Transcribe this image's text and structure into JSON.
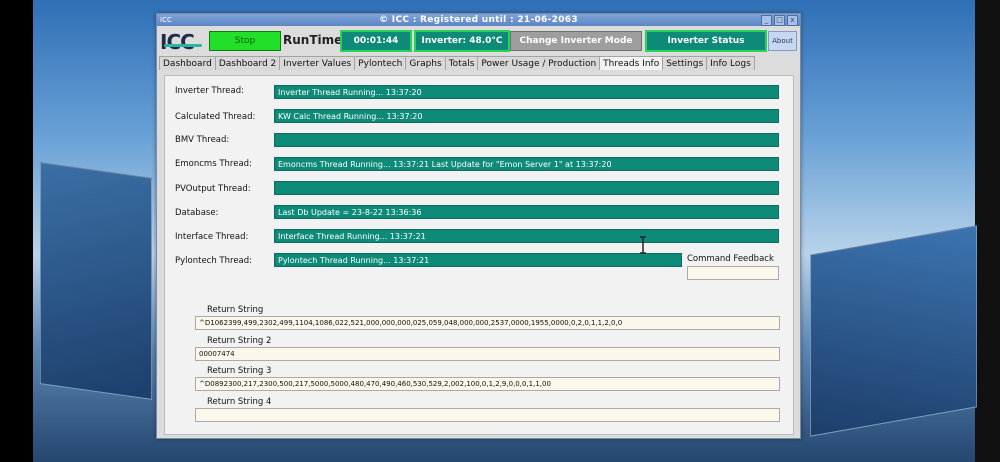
{
  "window": {
    "app_icon_label": "ICC",
    "title": "© ICC : Registered until : 21-06-2063",
    "controls": [
      "_",
      "□",
      "x"
    ]
  },
  "toolbar": {
    "logo_text": "ICC",
    "stop_label": "Stop",
    "runtime_label": "RunTime",
    "runtime_value": "00:01:44",
    "inverter_temp": "Inverter: 48.0°C",
    "change_mode_label": "Change Inverter Mode",
    "inverter_status_label": "Inverter Status",
    "about_label": "About"
  },
  "tabs": [
    {
      "label": "Dashboard",
      "active": false
    },
    {
      "label": "Dashboard 2",
      "active": false
    },
    {
      "label": "Inverter Values",
      "active": false
    },
    {
      "label": "Pylontech",
      "active": false
    },
    {
      "label": "Graphs",
      "active": false
    },
    {
      "label": "Totals",
      "active": false
    },
    {
      "label": "Power Usage / Production",
      "active": false
    },
    {
      "label": "Threads Info",
      "active": true
    },
    {
      "label": "Settings",
      "active": false
    },
    {
      "label": "Info Logs",
      "active": false
    }
  ],
  "threads": [
    {
      "label": "Inverter Thread:",
      "status": "Inverter Thread Running...   13:37:20"
    },
    {
      "label": "Calculated Thread:",
      "status": "KW Calc Thread Running...   13:37:20"
    },
    {
      "label": "BMV Thread:",
      "status": ""
    },
    {
      "label": "Emoncms Thread:",
      "status": "Emoncms Thread Running...  13:37:21   Last Update for \"Emon Server 1\" at 13:37:20"
    },
    {
      "label": "PVOutput Thread:",
      "status": ""
    },
    {
      "label": "Database:",
      "status": "Last Db Update = 23-8-22 13:36:36"
    },
    {
      "label": "Interface Thread:",
      "status": "Interface Thread Running...   13:37:21"
    },
    {
      "label": "Pylontech Thread:",
      "status": "Pylontech Thread Running...   13:37:21"
    }
  ],
  "command_feedback": {
    "label": "Command Feedback",
    "value": ""
  },
  "return_strings": [
    {
      "label": "Return String",
      "value": "^D1062399,499,2302,499,1104,1086,022,521,000,000,000,025,059,048,000,000,2537,0000,1955,0000,0,2,0,1,1,2,0,0"
    },
    {
      "label": "Return String 2",
      "value": "00007474"
    },
    {
      "label": "Return String 3",
      "value": "^D0892300,217,2300,500,217,5000,5000,480,470,490,460,530,529,2,002,100,0,1,2,9,0,0,0,1,1,00"
    },
    {
      "label": "Return String 4",
      "value": ""
    }
  ]
}
